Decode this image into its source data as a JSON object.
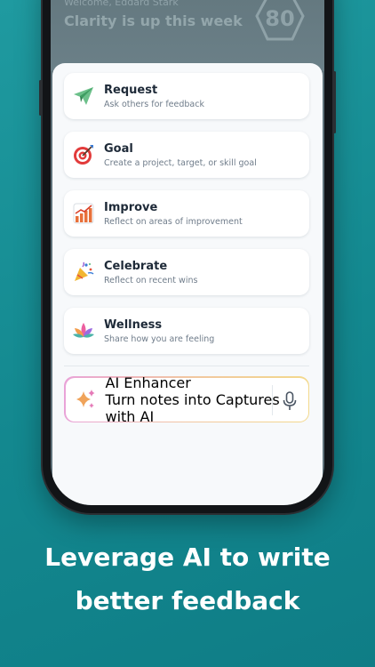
{
  "header": {
    "welcome": "Welcome, Eddard Stark",
    "headline": "Clarity is up this week",
    "score": "80"
  },
  "menu": [
    {
      "title": "Request",
      "subtitle": "Ask others for feedback",
      "icon": "paper-plane-icon"
    },
    {
      "title": "Goal",
      "subtitle": "Create a project, target, or skill goal",
      "icon": "target-icon"
    },
    {
      "title": "Improve",
      "subtitle": "Reflect on areas of improvement",
      "icon": "bar-chart-icon"
    },
    {
      "title": "Celebrate",
      "subtitle": "Reflect on recent wins",
      "icon": "party-popper-icon"
    },
    {
      "title": "Wellness",
      "subtitle": "Share how you are feeling",
      "icon": "lotus-icon"
    }
  ],
  "ai": {
    "title": "AI Enhancer",
    "subtitle": "Turn notes into Captures with AI",
    "icon": "sparkles-icon",
    "mic_icon": "microphone-icon"
  },
  "tagline": {
    "line1": "Leverage AI to write",
    "line2": "better feedback"
  },
  "colors": {
    "background": "#13888f",
    "card": "#ffffff",
    "title_text": "#1e2a38",
    "subtitle_text": "#6f7c8a"
  }
}
